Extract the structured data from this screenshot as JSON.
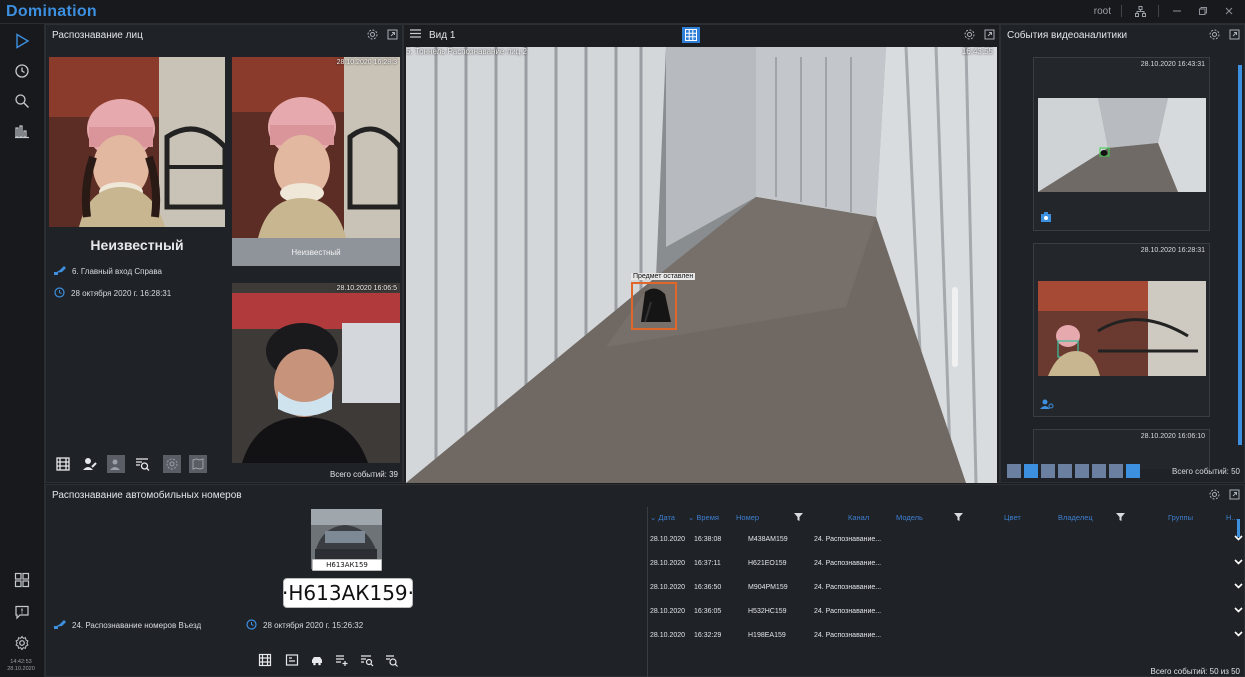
{
  "app": {
    "title": "Domination",
    "user": "root"
  },
  "nav": {
    "clock_time": "14:42:53",
    "clock_date": "28.10.2020"
  },
  "face_panel": {
    "title": "Распознавание лиц",
    "main_name": "Неизвестный",
    "main_channel": "6. Главный вход Справа",
    "main_datetime": "28 октября 2020 г. 16:28:31",
    "thumbs": [
      {
        "timestamp": "28.10.2020 16:28:3",
        "label": "Неизвестный"
      },
      {
        "timestamp": "28.10.2020 16:06:5",
        "label": ""
      }
    ],
    "total": "Всего событий: 39"
  },
  "video_panel": {
    "title": "Вид 1",
    "camera": "5. Тоннель Распознавание лиц 2",
    "time": "16:43:55",
    "detection_label": "Предмет оставлен"
  },
  "analytics_panel": {
    "title": "События видеоаналитики",
    "events": [
      {
        "timestamp": "28.10.2020 16:43:31"
      },
      {
        "timestamp": "28.10.2020 16:28:31"
      },
      {
        "timestamp": "28.10.2020 16:06:10"
      }
    ],
    "total": "Всего событий: 50"
  },
  "plates_panel": {
    "title": "Распознавание автомобильных номеров",
    "plate_small": "Н613АК159",
    "plate_big": "·Н613АК159·",
    "channel": "24. Распознавание номеров Въезд",
    "datetime": "28 октября 2020 г. 15:26:32",
    "columns": [
      "Дата",
      "Время",
      "Номер",
      "Канал",
      "Модель",
      "Цвет",
      "Владелец",
      "Группы",
      "Н..."
    ],
    "rows": [
      {
        "date": "28.10.2020",
        "time": "16:38:08",
        "number": "М438АМ159",
        "channel": "24. Распознавание..."
      },
      {
        "date": "28.10.2020",
        "time": "16:37:11",
        "number": "Н621ЕО159",
        "channel": "24. Распознавание..."
      },
      {
        "date": "28.10.2020",
        "time": "16:36:50",
        "number": "М904РМ159",
        "channel": "24. Распознавание..."
      },
      {
        "date": "28.10.2020",
        "time": "16:36:05",
        "number": "Н532НС159",
        "channel": "24. Распознавание..."
      },
      {
        "date": "28.10.2020",
        "time": "16:32:29",
        "number": "Н198ЕА159",
        "channel": "24. Распознавание..."
      }
    ],
    "total": "Всего событий: 50 из 50"
  },
  "colors": {
    "accent": "#3d8fe0",
    "background": "#1b1d20",
    "panel": "#1f2226",
    "detection_box": "#e0662a",
    "face_box": "#37c3a0"
  }
}
